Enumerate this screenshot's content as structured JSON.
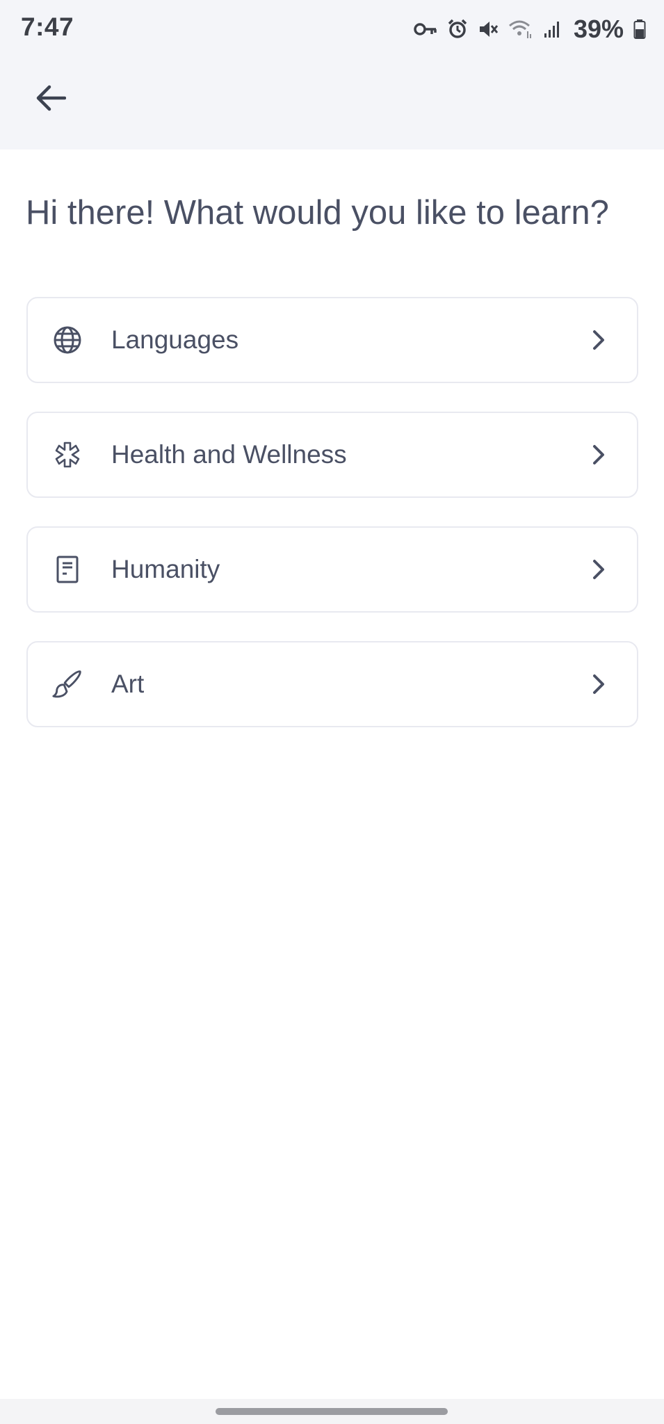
{
  "status_bar": {
    "time": "7:47",
    "battery": "39%",
    "icons": [
      "key-icon",
      "alarm-icon",
      "mute-icon",
      "wifi-icon",
      "signal-icon",
      "battery-icon"
    ]
  },
  "header": {
    "back_icon": "arrow-left-icon"
  },
  "main": {
    "heading": "Hi there! What would you like to learn?",
    "categories": [
      {
        "label": "Languages",
        "icon": "globe-icon"
      },
      {
        "label": "Health and Wellness",
        "icon": "asterisk-icon"
      },
      {
        "label": "Humanity",
        "icon": "book-icon"
      },
      {
        "label": "Art",
        "icon": "paintbrush-icon"
      }
    ]
  },
  "colors": {
    "header_bg": "#f4f5f9",
    "text": "#4a5064",
    "card_border": "#e8e9f0"
  }
}
